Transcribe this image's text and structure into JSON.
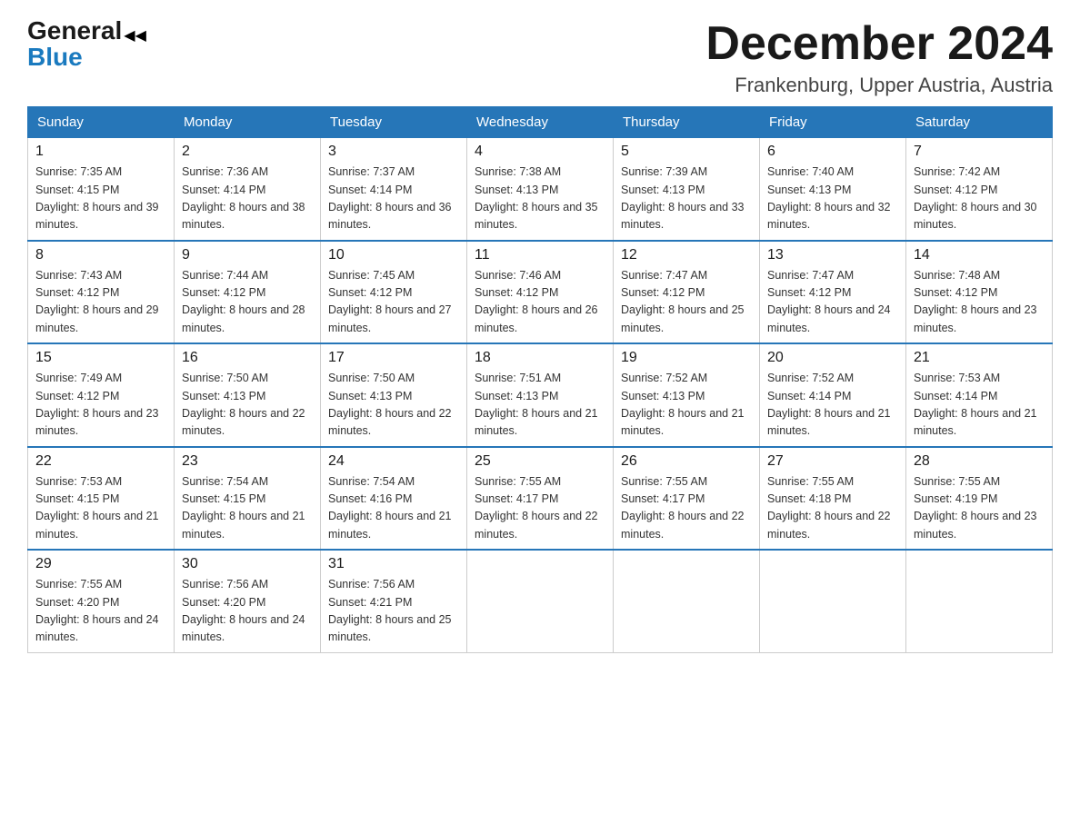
{
  "header": {
    "logo_general": "General",
    "logo_blue": "Blue",
    "title": "December 2024",
    "subtitle": "Frankenburg, Upper Austria, Austria"
  },
  "columns": [
    "Sunday",
    "Monday",
    "Tuesday",
    "Wednesday",
    "Thursday",
    "Friday",
    "Saturday"
  ],
  "weeks": [
    [
      {
        "day": "1",
        "sunrise": "Sunrise: 7:35 AM",
        "sunset": "Sunset: 4:15 PM",
        "daylight": "Daylight: 8 hours and 39 minutes."
      },
      {
        "day": "2",
        "sunrise": "Sunrise: 7:36 AM",
        "sunset": "Sunset: 4:14 PM",
        "daylight": "Daylight: 8 hours and 38 minutes."
      },
      {
        "day": "3",
        "sunrise": "Sunrise: 7:37 AM",
        "sunset": "Sunset: 4:14 PM",
        "daylight": "Daylight: 8 hours and 36 minutes."
      },
      {
        "day": "4",
        "sunrise": "Sunrise: 7:38 AM",
        "sunset": "Sunset: 4:13 PM",
        "daylight": "Daylight: 8 hours and 35 minutes."
      },
      {
        "day": "5",
        "sunrise": "Sunrise: 7:39 AM",
        "sunset": "Sunset: 4:13 PM",
        "daylight": "Daylight: 8 hours and 33 minutes."
      },
      {
        "day": "6",
        "sunrise": "Sunrise: 7:40 AM",
        "sunset": "Sunset: 4:13 PM",
        "daylight": "Daylight: 8 hours and 32 minutes."
      },
      {
        "day": "7",
        "sunrise": "Sunrise: 7:42 AM",
        "sunset": "Sunset: 4:12 PM",
        "daylight": "Daylight: 8 hours and 30 minutes."
      }
    ],
    [
      {
        "day": "8",
        "sunrise": "Sunrise: 7:43 AM",
        "sunset": "Sunset: 4:12 PM",
        "daylight": "Daylight: 8 hours and 29 minutes."
      },
      {
        "day": "9",
        "sunrise": "Sunrise: 7:44 AM",
        "sunset": "Sunset: 4:12 PM",
        "daylight": "Daylight: 8 hours and 28 minutes."
      },
      {
        "day": "10",
        "sunrise": "Sunrise: 7:45 AM",
        "sunset": "Sunset: 4:12 PM",
        "daylight": "Daylight: 8 hours and 27 minutes."
      },
      {
        "day": "11",
        "sunrise": "Sunrise: 7:46 AM",
        "sunset": "Sunset: 4:12 PM",
        "daylight": "Daylight: 8 hours and 26 minutes."
      },
      {
        "day": "12",
        "sunrise": "Sunrise: 7:47 AM",
        "sunset": "Sunset: 4:12 PM",
        "daylight": "Daylight: 8 hours and 25 minutes."
      },
      {
        "day": "13",
        "sunrise": "Sunrise: 7:47 AM",
        "sunset": "Sunset: 4:12 PM",
        "daylight": "Daylight: 8 hours and 24 minutes."
      },
      {
        "day": "14",
        "sunrise": "Sunrise: 7:48 AM",
        "sunset": "Sunset: 4:12 PM",
        "daylight": "Daylight: 8 hours and 23 minutes."
      }
    ],
    [
      {
        "day": "15",
        "sunrise": "Sunrise: 7:49 AM",
        "sunset": "Sunset: 4:12 PM",
        "daylight": "Daylight: 8 hours and 23 minutes."
      },
      {
        "day": "16",
        "sunrise": "Sunrise: 7:50 AM",
        "sunset": "Sunset: 4:13 PM",
        "daylight": "Daylight: 8 hours and 22 minutes."
      },
      {
        "day": "17",
        "sunrise": "Sunrise: 7:50 AM",
        "sunset": "Sunset: 4:13 PM",
        "daylight": "Daylight: 8 hours and 22 minutes."
      },
      {
        "day": "18",
        "sunrise": "Sunrise: 7:51 AM",
        "sunset": "Sunset: 4:13 PM",
        "daylight": "Daylight: 8 hours and 21 minutes."
      },
      {
        "day": "19",
        "sunrise": "Sunrise: 7:52 AM",
        "sunset": "Sunset: 4:13 PM",
        "daylight": "Daylight: 8 hours and 21 minutes."
      },
      {
        "day": "20",
        "sunrise": "Sunrise: 7:52 AM",
        "sunset": "Sunset: 4:14 PM",
        "daylight": "Daylight: 8 hours and 21 minutes."
      },
      {
        "day": "21",
        "sunrise": "Sunrise: 7:53 AM",
        "sunset": "Sunset: 4:14 PM",
        "daylight": "Daylight: 8 hours and 21 minutes."
      }
    ],
    [
      {
        "day": "22",
        "sunrise": "Sunrise: 7:53 AM",
        "sunset": "Sunset: 4:15 PM",
        "daylight": "Daylight: 8 hours and 21 minutes."
      },
      {
        "day": "23",
        "sunrise": "Sunrise: 7:54 AM",
        "sunset": "Sunset: 4:15 PM",
        "daylight": "Daylight: 8 hours and 21 minutes."
      },
      {
        "day": "24",
        "sunrise": "Sunrise: 7:54 AM",
        "sunset": "Sunset: 4:16 PM",
        "daylight": "Daylight: 8 hours and 21 minutes."
      },
      {
        "day": "25",
        "sunrise": "Sunrise: 7:55 AM",
        "sunset": "Sunset: 4:17 PM",
        "daylight": "Daylight: 8 hours and 22 minutes."
      },
      {
        "day": "26",
        "sunrise": "Sunrise: 7:55 AM",
        "sunset": "Sunset: 4:17 PM",
        "daylight": "Daylight: 8 hours and 22 minutes."
      },
      {
        "day": "27",
        "sunrise": "Sunrise: 7:55 AM",
        "sunset": "Sunset: 4:18 PM",
        "daylight": "Daylight: 8 hours and 22 minutes."
      },
      {
        "day": "28",
        "sunrise": "Sunrise: 7:55 AM",
        "sunset": "Sunset: 4:19 PM",
        "daylight": "Daylight: 8 hours and 23 minutes."
      }
    ],
    [
      {
        "day": "29",
        "sunrise": "Sunrise: 7:55 AM",
        "sunset": "Sunset: 4:20 PM",
        "daylight": "Daylight: 8 hours and 24 minutes."
      },
      {
        "day": "30",
        "sunrise": "Sunrise: 7:56 AM",
        "sunset": "Sunset: 4:20 PM",
        "daylight": "Daylight: 8 hours and 24 minutes."
      },
      {
        "day": "31",
        "sunrise": "Sunrise: 7:56 AM",
        "sunset": "Sunset: 4:21 PM",
        "daylight": "Daylight: 8 hours and 25 minutes."
      },
      null,
      null,
      null,
      null
    ]
  ]
}
